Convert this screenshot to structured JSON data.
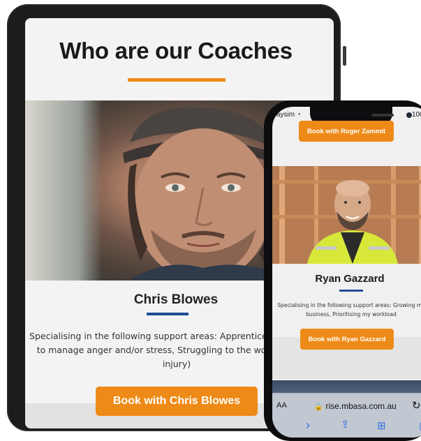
{
  "tablet": {
    "heading": "Who are our Coaches",
    "coach_name": "Chris Blowes",
    "description": "Specialising in the following support areas: Apprentice C Struggling to manage anger and/or stress, Struggling to the workforce (i.e. injury)",
    "book_button": "Book with Chris Blowes"
  },
  "phone": {
    "status_carrier": "aysim",
    "status_battery": "100",
    "top_button": "Book with Roger Zammit",
    "coach_name": "Ryan Gazzard",
    "description": "Specialising in the following support areas: Growing my business, Prioritising my workload",
    "book_button": "Book with Ryan Gazzard",
    "text_size_label": "AA",
    "url": "rise.mbasa.com.au"
  },
  "colors": {
    "accent_orange": "#ee8a17",
    "accent_blue": "#1f4c97"
  },
  "icons": [
    "wifi-icon",
    "lock-icon",
    "reload-icon",
    "back-icon",
    "share-icon",
    "bookmarks-icon",
    "tabs-icon"
  ]
}
